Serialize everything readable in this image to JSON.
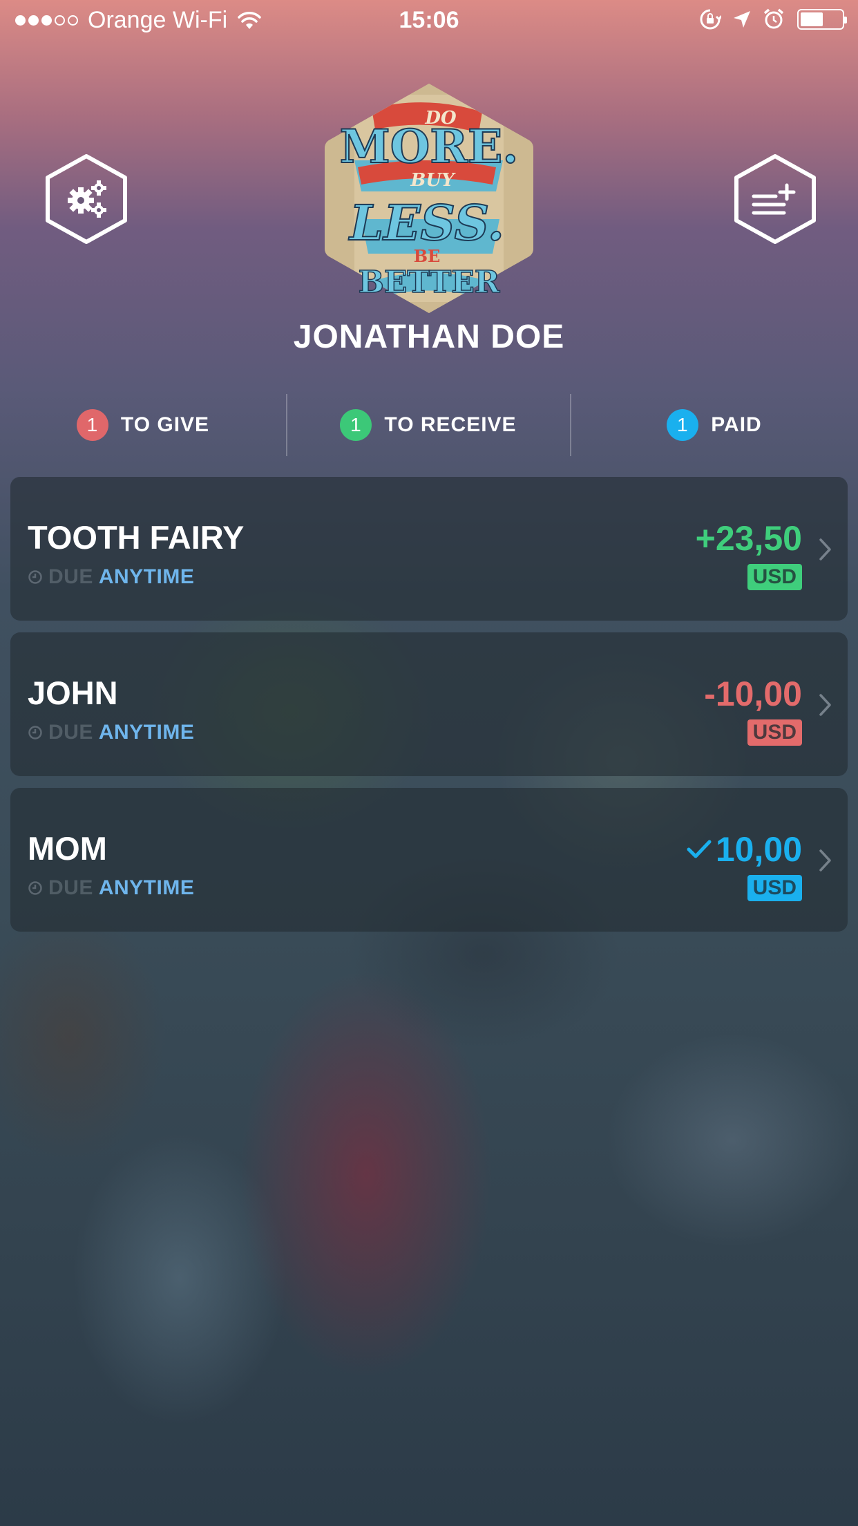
{
  "status_bar": {
    "carrier": "Orange Wi-Fi",
    "time": "15:06",
    "signal_bars_filled": 3,
    "signal_bars_total": 5,
    "battery_level": 0.55,
    "icons": [
      "wifi-icon",
      "rotation-lock-icon",
      "location-arrow-icon",
      "alarm-icon",
      "battery-icon"
    ]
  },
  "header": {
    "settings_icon": "gears-icon",
    "add_icon": "add-list-icon",
    "avatar_text": [
      "DO",
      "MORE.",
      "BUY",
      "LESS.",
      "BE",
      "BETTER"
    ],
    "user_name": "JONATHAN DOE"
  },
  "tabs": [
    {
      "count": "1",
      "label": "TO GIVE",
      "color": "#e0676a"
    },
    {
      "count": "1",
      "label": "TO RECEIVE",
      "color": "#3cc878"
    },
    {
      "count": "1",
      "label": "PAID",
      "color": "#1ab0ee"
    }
  ],
  "debts": [
    {
      "name": "TOOTH FAIRY",
      "due_label": "DUE",
      "due_value": "ANYTIME",
      "amount": "+23,50",
      "currency": "USD",
      "color": "#3fce7c",
      "status": "receive"
    },
    {
      "name": "JOHN",
      "due_label": "DUE",
      "due_value": "ANYTIME",
      "amount": "-10,00",
      "currency": "USD",
      "color": "#e36b6b",
      "status": "give"
    },
    {
      "name": "MOM",
      "due_label": "DUE",
      "due_value": "ANYTIME",
      "amount": "10,00",
      "currency": "USD",
      "color": "#1ab0ee",
      "status": "paid"
    }
  ]
}
